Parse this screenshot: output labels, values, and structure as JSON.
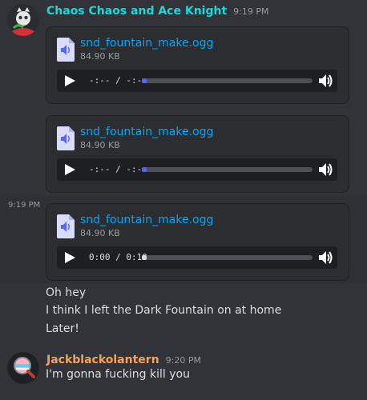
{
  "messages": [
    {
      "author": "Chaos Chaos and Ace Knight",
      "author_color": "#1ad9d9",
      "timestamp": "9:19 PM",
      "attachments": [
        {
          "filename": "snd_fountain_make.ogg",
          "size": "84.90 KB",
          "time": "-:-- / -:--",
          "progress": 0
        },
        {
          "filename": "snd_fountain_make.ogg",
          "size": "84.90 KB",
          "time": "-:-- / -:--",
          "progress": 0
        }
      ]
    },
    {
      "side_timestamp": "9:19 PM",
      "attachment": {
        "filename": "snd_fountain_make.ogg",
        "size": "84.90 KB",
        "time": "0:00 / 0:10",
        "progress": 0
      }
    },
    {
      "text": "Oh hey"
    },
    {
      "text": "I think I left the Dark Fountain on at home"
    },
    {
      "text": "Later!"
    },
    {
      "author": "Jackblackolantern",
      "author_color": "#f5a35b",
      "timestamp": "9:20 PM",
      "text": "I'm gonna fucking kill you"
    }
  ],
  "icons": {
    "file": "audio-file-icon",
    "play": "play-icon",
    "volume": "volume-icon"
  },
  "colors": {
    "background": "#313338",
    "link": "#00a8fc",
    "accent": "#5865f2"
  }
}
